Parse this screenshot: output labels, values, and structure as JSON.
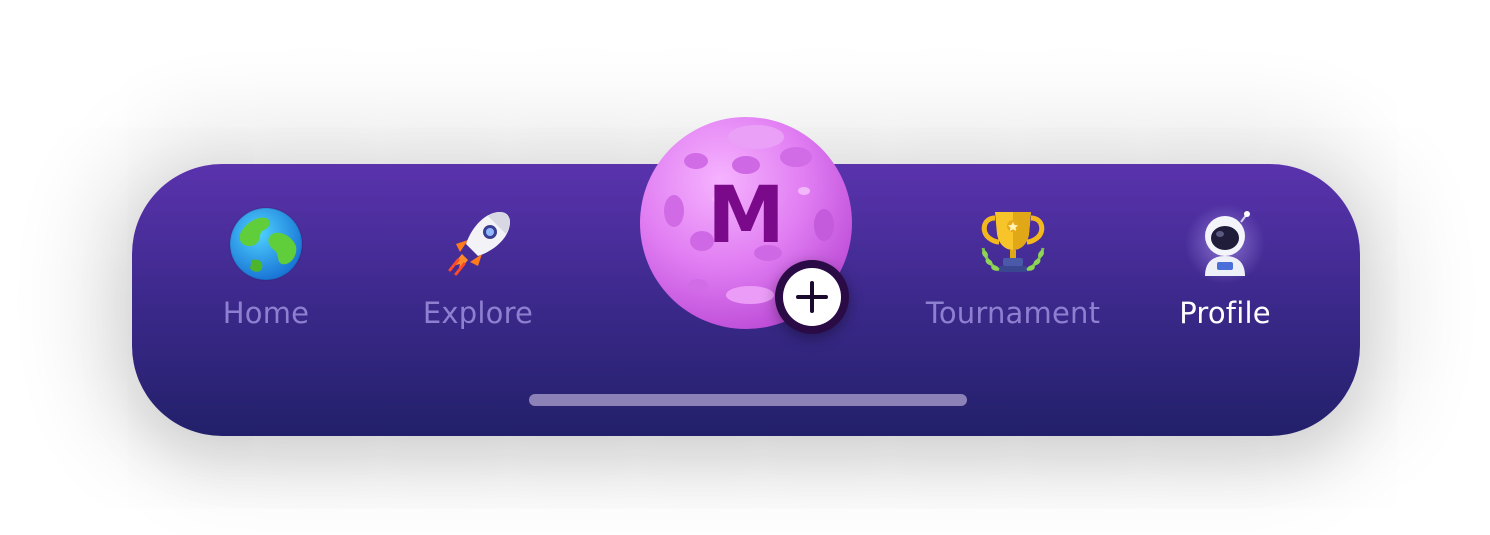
{
  "tabs": [
    {
      "id": "home",
      "label": "Home",
      "icon": "earth-globe-icon",
      "active": false
    },
    {
      "id": "explore",
      "label": "Explore",
      "icon": "rocket-icon",
      "active": false
    },
    {
      "id": "tournament",
      "label": "Tournament",
      "icon": "trophy-icon",
      "active": false
    },
    {
      "id": "profile",
      "label": "Profile",
      "icon": "astronaut-icon",
      "active": true
    }
  ],
  "create_button": {
    "letter": "M",
    "icon": "plus-icon"
  },
  "colors": {
    "bar_top": "#5a33ad",
    "bar_bottom": "#22206a",
    "inactive_label": "#8f7fd1",
    "active_label": "#ffffff",
    "planet": "#e37af0",
    "letter": "#7a0a8a",
    "badge": "#2a0b45"
  }
}
